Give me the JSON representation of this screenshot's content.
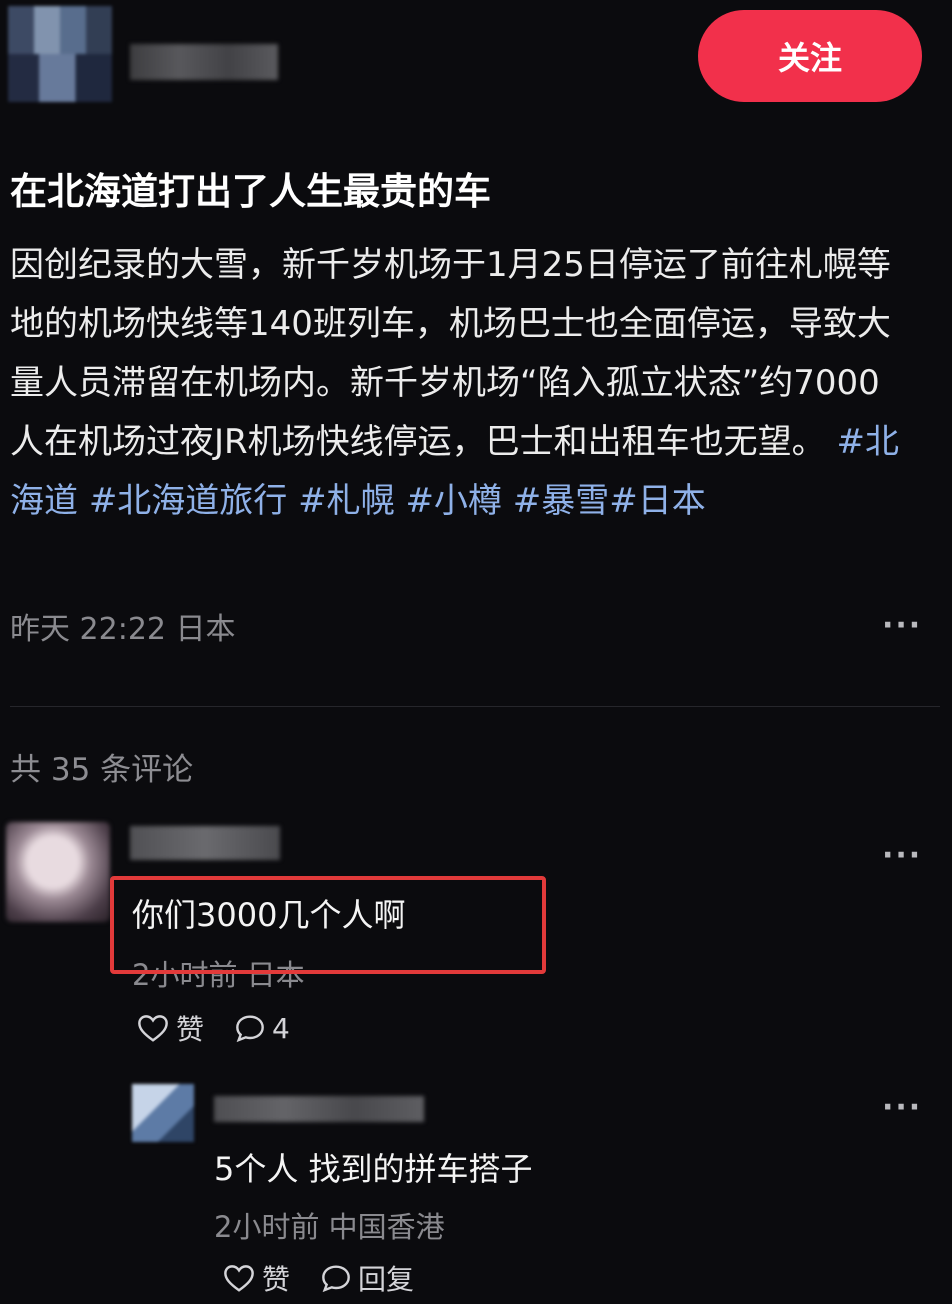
{
  "header": {
    "follow_label": "关注"
  },
  "post": {
    "title": "在北海道打出了人生最贵的车",
    "body_text": "因创纪录的大雪，新千岁机场于1月25日停运了前往札幌等地的机场快线等140班列车，机场巴士也全面停运，导致大量人员滞留在机场内。新千岁机场“陷入孤立状态”约7000人在机场过夜JR机场快线停运，巴士和出租车也无望。",
    "tags": [
      "#北海道",
      "#北海道旅行",
      "#札幌",
      "#小樽",
      "#暴雪",
      "#日本"
    ],
    "time": "昨天 22:22",
    "location": "日本"
  },
  "comments_header": "共 35 条评论",
  "comments": [
    {
      "text": "你们3000几个人啊",
      "time": "2小时前",
      "location": "日本",
      "like_label": "赞",
      "reply_count": "4"
    }
  ],
  "reply": {
    "text": "5个人 找到的拼车搭子",
    "time": "2小时前",
    "location": "中国香港",
    "like_label": "赞",
    "reply_label": "回复"
  },
  "colors": {
    "background": "#0b0b0e",
    "follow_button": "#f2304b",
    "tag": "#8fb1e8",
    "highlight_box": "#e23a3a"
  },
  "icons": [
    "more-icon",
    "heart-icon",
    "comment-bubble-icon"
  ]
}
